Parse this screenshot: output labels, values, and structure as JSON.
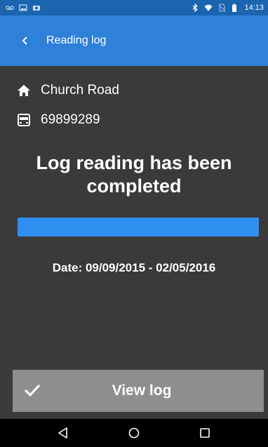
{
  "status_bar": {
    "time": "14:13",
    "left_icons": [
      "voicemail-icon",
      "image-icon",
      "camera-icon"
    ],
    "right_icons": [
      "bluetooth-icon",
      "wifi-icon",
      "no-sim-icon",
      "battery-icon"
    ]
  },
  "app_bar": {
    "back_icon": "chevron-left-icon",
    "title": "Reading log"
  },
  "address": {
    "icon": "home-icon",
    "text": "Church Road"
  },
  "meter": {
    "icon": "meter-icon",
    "number": "69899289"
  },
  "status_message": "Log reading has been completed",
  "progress": {
    "fraction": 1.0,
    "color": "#2e8ff0"
  },
  "date_range": "Date: 09/09/2015 - 02/05/2016",
  "action_button": {
    "icon": "check-icon",
    "label": "View log"
  },
  "navigation": {
    "back_icon": "nav-back-icon",
    "home_icon": "nav-home-icon",
    "recents_icon": "nav-recents-icon"
  },
  "colors": {
    "status_bar": "#1a64b0",
    "app_bar": "#2e80d8",
    "background": "#3a3a3a",
    "button": "#8e8e8e"
  }
}
